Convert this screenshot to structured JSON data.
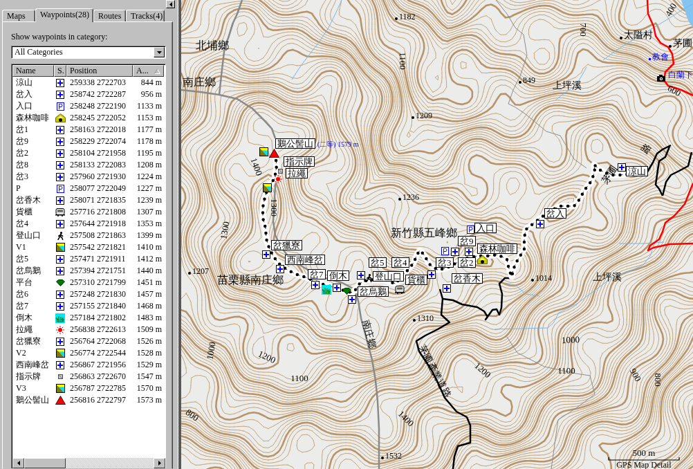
{
  "panel": {
    "tabs": [
      {
        "label": "Maps",
        "selected": false
      },
      {
        "label": "Waypoints(28)",
        "selected": true
      },
      {
        "label": "Routes",
        "selected": false
      },
      {
        "label": "Tracks(4)",
        "selected": false
      }
    ],
    "category_label": "Show waypoints in category:",
    "category": {
      "value": "All Categories"
    },
    "table": {
      "columns": [
        {
          "label": "Name",
          "sorted": false
        },
        {
          "label": "S.",
          "sorted": false
        },
        {
          "label": "Position",
          "sorted": false
        },
        {
          "label": "A...",
          "sorted": true
        }
      ],
      "rows": [
        {
          "name": "涼山",
          "kind": "cross",
          "position": "259338 2722703",
          "altitude": "844 m"
        },
        {
          "name": "岔入",
          "kind": "cross",
          "position": "258742 2722287",
          "altitude": "956 m"
        },
        {
          "name": "入口",
          "kind": "parking",
          "glyph": "P",
          "position": "258248 2722190",
          "altitude": "1133 m"
        },
        {
          "name": "森林咖啡",
          "kind": "cafe",
          "position": "258245 2722052",
          "altitude": "1153 m"
        },
        {
          "name": "岔1",
          "kind": "cross",
          "position": "258163 2722018",
          "altitude": "1177 m"
        },
        {
          "name": "岔9",
          "kind": "cross",
          "position": "258229 2722074",
          "altitude": "1178 m"
        },
        {
          "name": "岔2",
          "kind": "cross",
          "position": "258104 2721958",
          "altitude": "1195 m"
        },
        {
          "name": "岔8",
          "kind": "cross",
          "position": "258133 2722083",
          "altitude": "1208 m"
        },
        {
          "name": "岔3",
          "kind": "cross",
          "position": "257960 2721930",
          "altitude": "1224 m"
        },
        {
          "name": "P",
          "kind": "parking",
          "glyph": "P",
          "position": "258077 2722049",
          "altitude": "1227 m"
        },
        {
          "name": "岔香木",
          "kind": "cross",
          "position": "258071 2721835",
          "altitude": "1239 m"
        },
        {
          "name": "貨櫃",
          "kind": "container",
          "position": "257716 2721808",
          "altitude": "1307 m"
        },
        {
          "name": "岔4",
          "kind": "cross",
          "position": "257644 2721918",
          "altitude": "1353 m"
        },
        {
          "name": "登山口",
          "kind": "hiker",
          "position": "257508 2721863",
          "altitude": "1399 m"
        },
        {
          "name": "V1",
          "kind": "view",
          "position": "257542 2721821",
          "altitude": "1410 m"
        },
        {
          "name": "岔5",
          "kind": "cross",
          "position": "257471 2721911",
          "altitude": "1412 m"
        },
        {
          "name": "岔烏鵝",
          "kind": "cross",
          "position": "257394 2721751",
          "altitude": "1440 m"
        },
        {
          "name": "平台",
          "kind": "platform",
          "position": "257310 2721799",
          "altitude": "1451 m"
        },
        {
          "name": "岔6",
          "kind": "cross",
          "position": "257248 2721830",
          "altitude": "1457 m"
        },
        {
          "name": "岔7",
          "kind": "cross",
          "position": "257155 2721840",
          "altitude": "1468 m"
        },
        {
          "name": "倒木",
          "kind": "marsh",
          "position": "257184 2721802",
          "altitude": "1483 m"
        },
        {
          "name": "拉繩",
          "kind": "rope",
          "position": "256838 2722613",
          "altitude": "1509 m"
        },
        {
          "name": "岔獵寮",
          "kind": "cross",
          "position": "256764 2722068",
          "altitude": "1526 m"
        },
        {
          "name": "V2",
          "kind": "view",
          "position": "256774 2722544",
          "altitude": "1528 m"
        },
        {
          "name": "西南峰岔",
          "kind": "cross",
          "position": "256867 2721956",
          "altitude": "1529 m"
        },
        {
          "name": "指示牌",
          "kind": "sign",
          "position": "256863 2722670",
          "altitude": "1547 m"
        },
        {
          "name": "V3",
          "kind": "view",
          "position": "256787 2722785",
          "altitude": "1570 m"
        },
        {
          "name": "鵝公髻山",
          "kind": "summit",
          "position": "256816 2722797",
          "altitude": "1573 m"
        }
      ]
    }
  },
  "map": {
    "places": [
      {
        "label": "北埔鄉",
        "kind": "region"
      },
      {
        "label": "南庄鄉",
        "kind": "region"
      },
      {
        "label": "上坪溪",
        "kind": "stream"
      },
      {
        "label": "太隘村",
        "kind": "village"
      },
      {
        "label": "茅圃",
        "kind": "village"
      },
      {
        "label": "教會",
        "kind": "poi_point"
      },
      {
        "label": "白蘭下",
        "kind": "poi"
      },
      {
        "label": "新竹縣五峰鄉",
        "kind": "region"
      },
      {
        "label": "苗栗縣南庄鄉",
        "kind": "region"
      },
      {
        "label": "上坪溪",
        "kind": "stream"
      },
      {
        "label": "南庄鄉",
        "kind": "road"
      },
      {
        "label": "茅圃產業道路",
        "kind": "road"
      },
      {
        "label": "茅圃",
        "kind": "road"
      },
      {
        "label": "路",
        "kind": "road"
      }
    ],
    "spot_heights": [
      "1182",
      "1209",
      "1236",
      "849",
      "1207",
      "1310",
      "1014",
      "1532"
    ],
    "contour_labels": [
      "1100",
      "700",
      "400",
      "600",
      "1400",
      "1300",
      "1300",
      "1000",
      "1200",
      "1100",
      "800",
      "1400",
      "1000",
      "1100",
      "1200",
      "900",
      "800"
    ],
    "markers": [
      {
        "kind": "camera"
      },
      {
        "kind": "view"
      },
      {
        "kind": "summit"
      },
      {
        "kind": "sign"
      },
      {
        "kind": "cross"
      },
      {
        "kind": "rope"
      },
      {
        "kind": "view"
      },
      {
        "kind": "cross"
      },
      {
        "kind": "parking",
        "glyph": "P"
      },
      {
        "kind": "cross"
      },
      {
        "kind": "parking",
        "glyph": "P"
      },
      {
        "kind": "cross"
      },
      {
        "kind": "cross"
      },
      {
        "kind": "cafe"
      },
      {
        "kind": "cross"
      },
      {
        "kind": "cross"
      },
      {
        "kind": "marsh"
      },
      {
        "kind": "cross"
      },
      {
        "kind": "platform"
      },
      {
        "kind": "cross"
      },
      {
        "kind": "cross"
      },
      {
        "kind": "hiker"
      },
      {
        "kind": "container"
      },
      {
        "kind": "cross"
      },
      {
        "kind": "cross"
      }
    ],
    "waypoint_labels": [
      "鵝公髻山",
      "指示牌",
      "拉繩",
      "涼山",
      "岔入",
      "入口",
      "岔獵寮",
      "岔9",
      "森林咖啡",
      "西南峰岔",
      "岔5",
      "岔4",
      "岔3",
      "岔2",
      "岔7",
      "倒木",
      "登山口",
      "貨櫃",
      "岔香木",
      "岔烏鵝"
    ],
    "summit_note": "(二等) 1579 m",
    "scale": "500 m",
    "caption": "GPS Map Detail"
  }
}
